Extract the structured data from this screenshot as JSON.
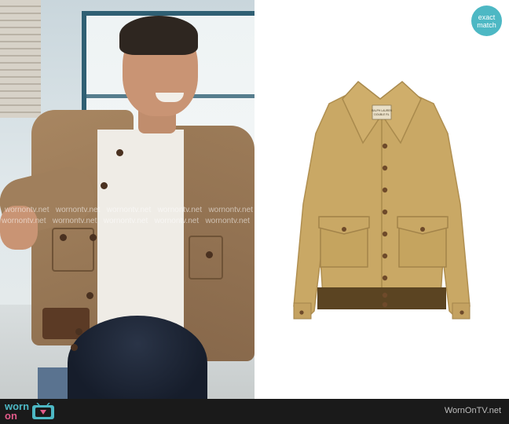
{
  "badge": {
    "line1": "exact",
    "line2": "match"
  },
  "watermark": {
    "text": "wornontv.net",
    "rows": [
      [
        "wornontv.net",
        "wornontv.net",
        "wornontv.net",
        "wornontv.net",
        "wornontv.net"
      ],
      [
        "wornontv.net",
        "wornontv.net",
        "wornontv.net",
        "wornontv.net",
        "wornontv.net"
      ]
    ]
  },
  "bottom_bar": {
    "logo_worn": "worn",
    "logo_on": "on",
    "logo_icon": "tv-icon",
    "site": "WornOnTV.net"
  },
  "product": {
    "image": "jacket-product-image",
    "label_lines": [
      "RALPH LAUREN",
      "DOUBLE RL"
    ]
  },
  "colors": {
    "accent": "#4db8c4",
    "logo_pink": "#e35b8a",
    "bar": "#1a1a1a",
    "jacket": "#c9a865",
    "rib": "#5b4422"
  }
}
